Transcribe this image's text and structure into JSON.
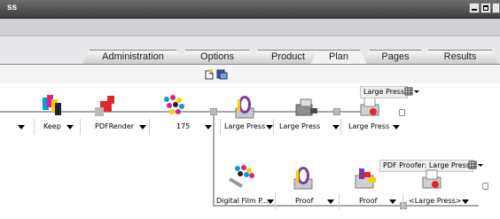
{
  "window": {
    "title": "ss"
  },
  "tabs": [
    {
      "label": "Administration"
    },
    {
      "label": "Options"
    },
    {
      "label": "Product"
    },
    {
      "label": "Plan",
      "active": true
    },
    {
      "label": "Pages"
    },
    {
      "label": "Results"
    }
  ],
  "flow": {
    "top_row": [
      {
        "label": ""
      },
      {
        "label": "Keep"
      },
      {
        "label": "PDFRender"
      },
      {
        "label": "175"
      },
      {
        "label": "Large Press"
      },
      {
        "label": "Large Press"
      },
      {
        "label": "Large Press"
      }
    ],
    "bottom_row": [
      {
        "label": "Digital Film P..."
      },
      {
        "label": "Proof"
      },
      {
        "label": "Proof"
      },
      {
        "label": "<Large Press>"
      }
    ],
    "badges": {
      "large_press": "Large Press",
      "pdf_proofer": "PDF Proofer: Large Press"
    }
  },
  "icons": [
    "new-document-icon",
    "run-plan-icon",
    "cmyk-separation-icon",
    "pdf-render-icon",
    "halftone-screen-icon",
    "press-gauge-icon",
    "imagesetter-icon",
    "printer-icon",
    "film-output-icon",
    "grid-menu-icon"
  ]
}
